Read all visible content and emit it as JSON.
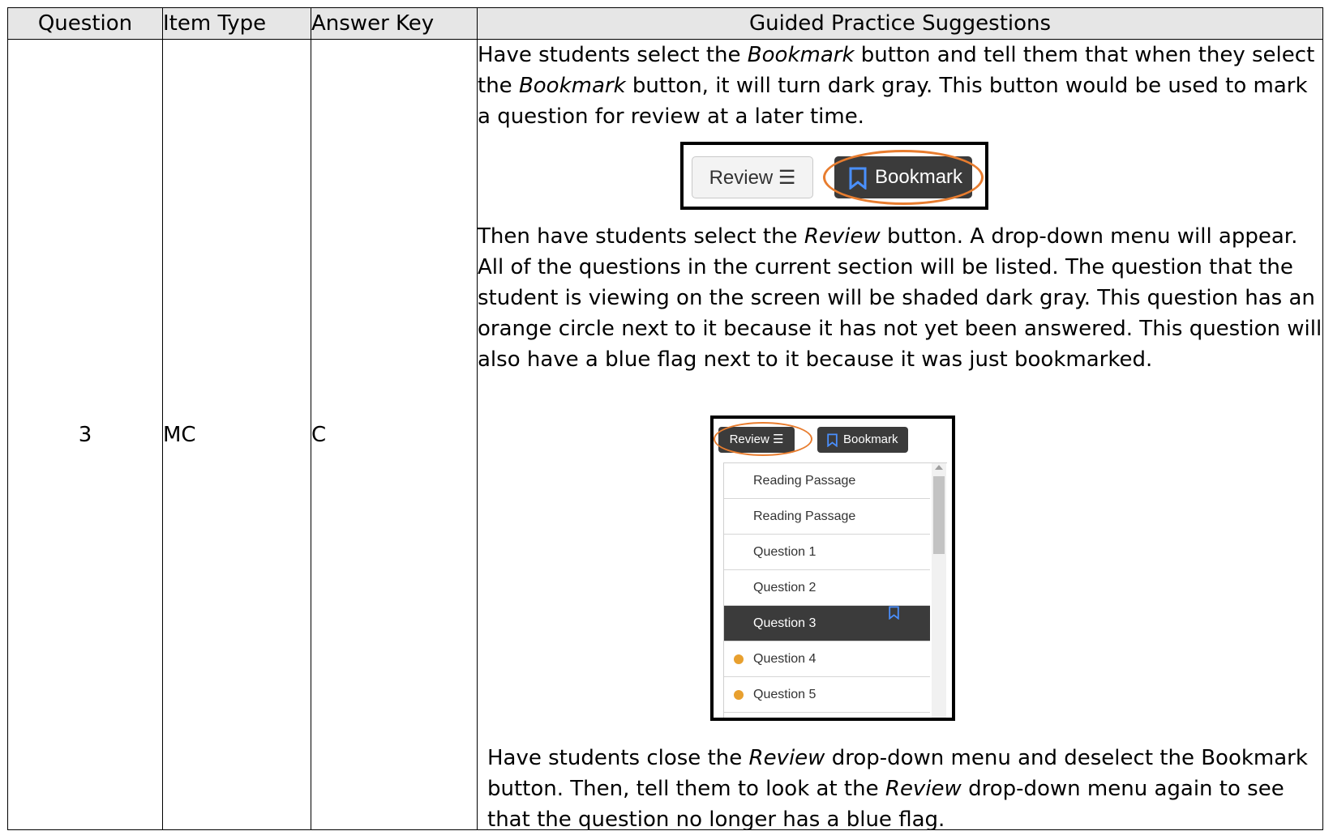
{
  "table": {
    "headers": {
      "question": "Question",
      "item_type": "Item Type",
      "answer_key": "Answer Key",
      "guided": "Guided Practice Suggestions"
    },
    "row": {
      "question": "3",
      "item_type": "MC",
      "answer_key": "C"
    }
  },
  "guided": {
    "p1": {
      "a": "Have students select the ",
      "b": "Bookmark",
      "c": " button and tell them that when they select the ",
      "d": "Bookmark",
      "e": " button, it will turn dark gray. This button would be used to mark a question for review at a later time."
    },
    "p2": {
      "a": "Then have students select the ",
      "b": "Review",
      "c": " button. A drop-down menu will appear. All of the questions in the current section will be listed. The question that the student is viewing on the screen will be shaded dark gray. This question has an orange circle next to it because it has not yet been answered. This question will also have a blue flag next to it because it was just bookmarked."
    },
    "p3": {
      "a": "Have students close the ",
      "b": "Review",
      "c": " drop-down menu and deselect the Bookmark button. Then, tell them to look at the ",
      "d": "Review",
      "e": " drop-down menu again to see that the question no longer has a blue flag."
    }
  },
  "figure1": {
    "review_label": "Review ☰",
    "bookmark_label": "Bookmark"
  },
  "figure2": {
    "review_label": "Review ☰",
    "bookmark_label": "Bookmark",
    "menu_items": [
      {
        "label": "Reading Passage",
        "current": false,
        "unanswered": false,
        "bookmarked": false
      },
      {
        "label": "Reading Passage",
        "current": false,
        "unanswered": false,
        "bookmarked": false
      },
      {
        "label": "Question 1",
        "current": false,
        "unanswered": false,
        "bookmarked": false
      },
      {
        "label": "Question 2",
        "current": false,
        "unanswered": false,
        "bookmarked": false
      },
      {
        "label": "Question 3",
        "current": true,
        "unanswered": false,
        "bookmarked": true
      },
      {
        "label": "Question 4",
        "current": false,
        "unanswered": true,
        "bookmarked": false
      },
      {
        "label": "Question 5",
        "current": false,
        "unanswered": true,
        "bookmarked": false
      }
    ]
  },
  "colors": {
    "header_bg": "#e6e6e6",
    "button_dark": "#3b3b3b",
    "highlight_ring": "#e87d2f",
    "unanswered_dot": "#e8a02f",
    "bookmark_blue": "#2f7be8"
  },
  "icons": {
    "bookmark": "bookmark-icon",
    "list": "list-icon"
  }
}
